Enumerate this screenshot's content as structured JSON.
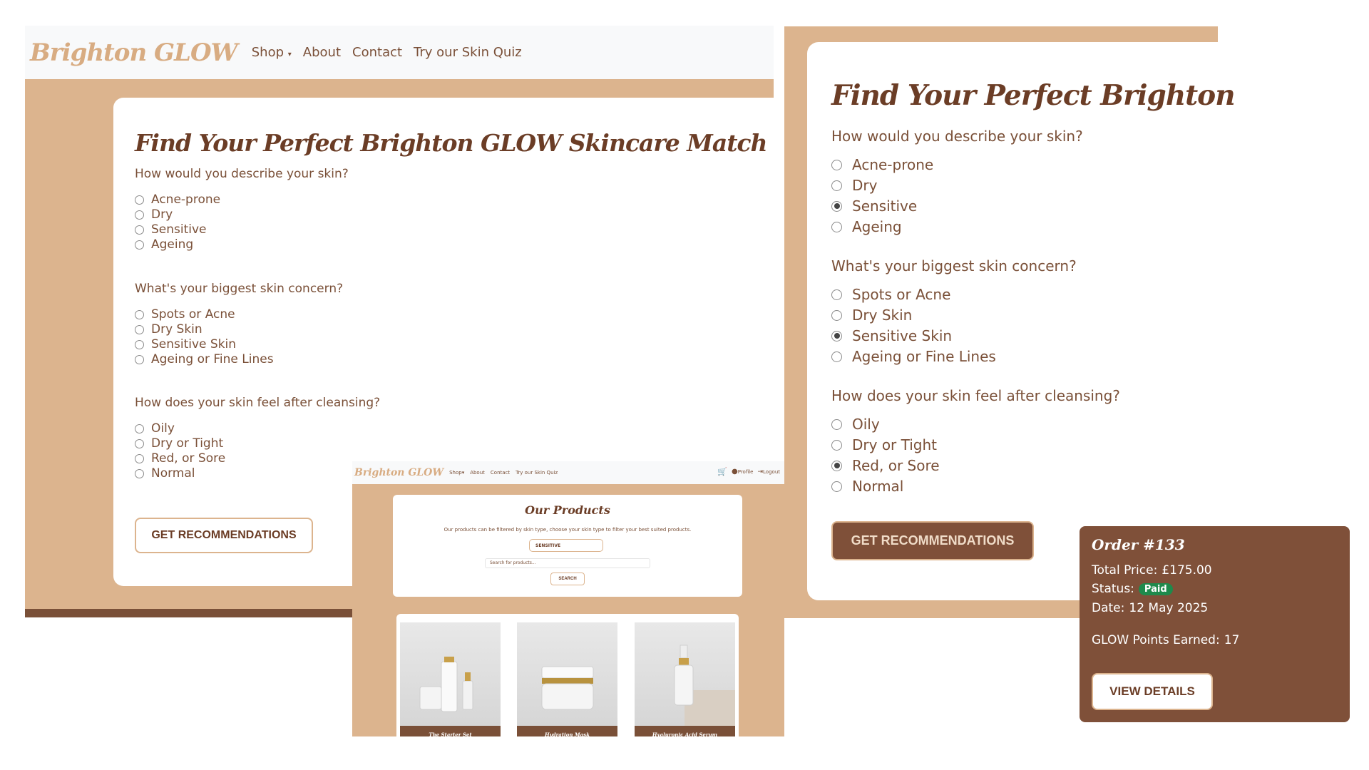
{
  "brand": "Brighton GLOW",
  "nav": {
    "shop": "Shop",
    "about": "About",
    "contact": "Contact",
    "quiz": "Try our Skin Quiz",
    "profile": "Profile",
    "logout": "Logout"
  },
  "quiz": {
    "title_full": "Find Your Perfect Brighton GLOW Skincare Match",
    "title_cropped": "Find Your Perfect Brighton",
    "questions": [
      {
        "text": "How would you describe your skin?",
        "options": [
          "Acne-prone",
          "Dry",
          "Sensitive",
          "Ageing"
        ],
        "selected_zoomed": "Sensitive"
      },
      {
        "text": "What's your biggest skin concern?",
        "options": [
          "Spots or Acne",
          "Dry Skin",
          "Sensitive Skin",
          "Ageing or Fine Lines"
        ],
        "selected_zoomed": "Sensitive Skin"
      },
      {
        "text": "How does your skin feel after cleansing?",
        "options": [
          "Oily",
          "Dry or Tight",
          "Red, or Sore",
          "Normal"
        ],
        "selected_zoomed": "Red, or Sore"
      }
    ],
    "button": "GET RECOMMENDATIONS"
  },
  "products": {
    "title": "Our Products",
    "subtitle": "Our products can be filtered by skin type, choose your skin type to filter your best suited products.",
    "filter_value": "SENSITIVE",
    "search_placeholder": "Search for products...",
    "search_button": "SEARCH",
    "items": [
      "The Starter Set",
      "Hydration Mask",
      "Hyaluronic Acid Serum"
    ]
  },
  "order": {
    "title": "Order #133",
    "total_label": "Total Price:",
    "total_value": "£175.00",
    "status_label": "Status:",
    "status_value": "Paid",
    "date_label": "Date:",
    "date_value": "12 May 2025",
    "points_label": "GLOW Points Earned:",
    "points_value": "17",
    "button": "VIEW DETAILS"
  },
  "colors": {
    "tan": "#dcb48e",
    "brown": "#7f5039",
    "dark_brown": "#6b3d26",
    "paid_green": "#1e8a4c"
  }
}
